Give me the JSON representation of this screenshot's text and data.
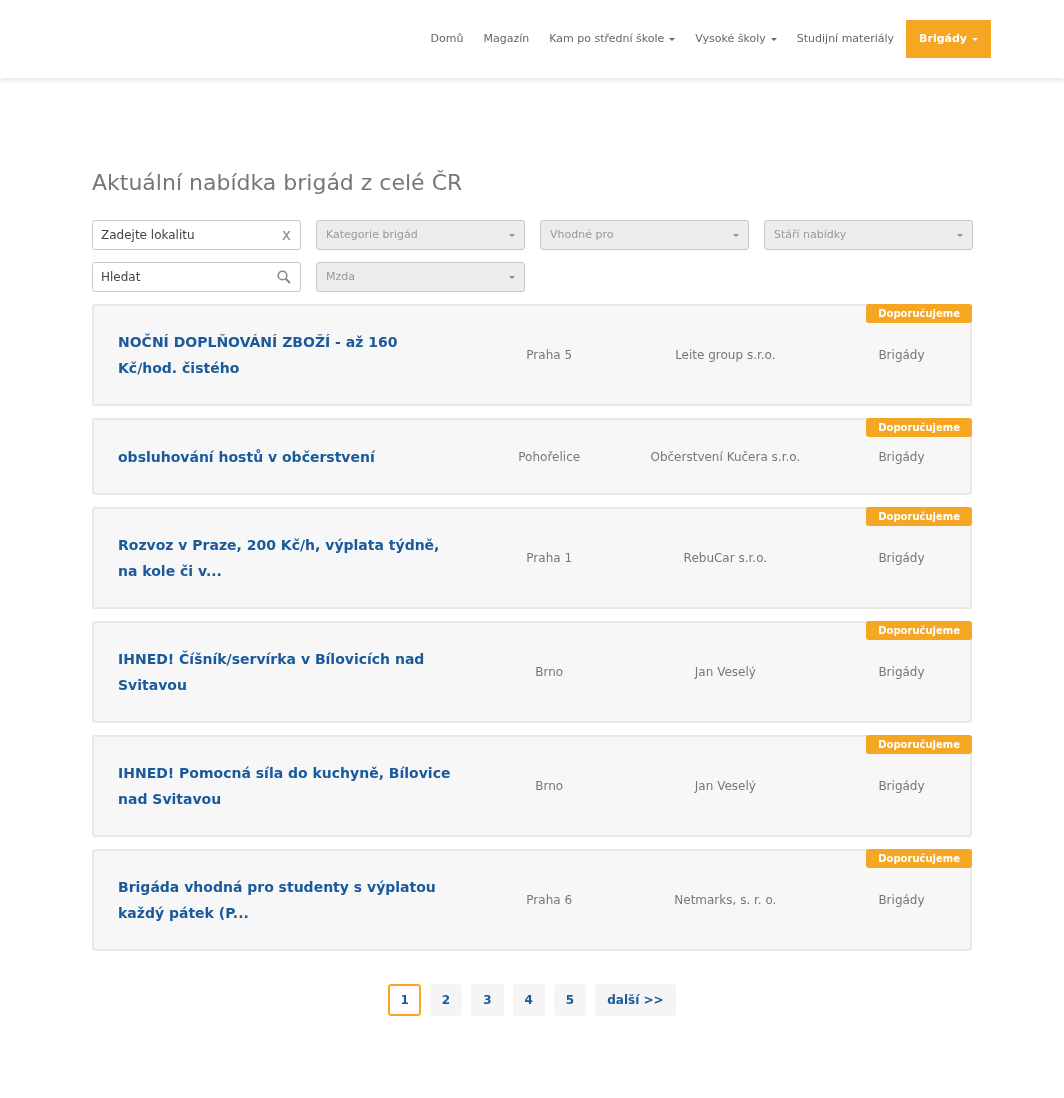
{
  "nav": [
    {
      "label": "Domů",
      "dropdown": false,
      "selected": false
    },
    {
      "label": "Magazín",
      "dropdown": false,
      "selected": false
    },
    {
      "label": "Kam po střední škole",
      "dropdown": true,
      "selected": false
    },
    {
      "label": "Vysoké školy",
      "dropdown": true,
      "selected": false
    },
    {
      "label": "Studijní materiály",
      "dropdown": false,
      "selected": false
    },
    {
      "label": "Brigády",
      "dropdown": true,
      "selected": true
    }
  ],
  "heading": "Aktuální nabídka brigád z celé ČR",
  "filters": [
    {
      "kind": "input",
      "placeholder": "Zadejte lokalitu",
      "clear": "x"
    },
    {
      "kind": "select",
      "placeholder": "Kategorie brigád"
    },
    {
      "kind": "select",
      "placeholder": "Vhodné pro"
    },
    {
      "kind": "select",
      "placeholder": "Stáří nabídky"
    },
    {
      "kind": "search",
      "placeholder": "Hledat"
    },
    {
      "kind": "select",
      "placeholder": "Mzda"
    }
  ],
  "jobs": [
    {
      "title": "NOČNÍ DOPLŇOVÁNÍ ZBOŽÍ - až 160 Kč/hod. čistého",
      "location": "Praha 5",
      "company": "Leite group s.r.o.",
      "category": "Brigády",
      "badge": "Doporučujeme"
    },
    {
      "title": "obsluhování hostů v občerstvení",
      "location": "Pohořelice",
      "company": "Občerstvení Kučera s.r.o.",
      "category": "Brigády",
      "badge": "Doporučujeme"
    },
    {
      "title": "Rozvoz v Praze, 200 Kč/h, výplata týdně, na kole či v...",
      "location": "Praha 1",
      "company": "RebuCar s.r.o.",
      "category": "Brigády",
      "badge": "Doporučujeme"
    },
    {
      "title": "IHNED! Číšník/servírka v Bílovicích nad Svitavou",
      "location": "Brno",
      "company": "Jan Veselý",
      "category": "Brigády",
      "badge": "Doporučujeme"
    },
    {
      "title": "IHNED! Pomocná síla do kuchyně, Bílovice nad Svitavou",
      "location": "Brno",
      "company": "Jan Veselý",
      "category": "Brigády",
      "badge": "Doporučujeme"
    },
    {
      "title": "Brigáda vhodná pro studenty s výplatou každý pátek (P...",
      "location": "Praha 6",
      "company": "Netmarks, s. r. o.",
      "category": "Brigády",
      "badge": "Doporučujeme"
    }
  ],
  "pagination": [
    {
      "label": "1",
      "selected": true
    },
    {
      "label": "2",
      "selected": false
    },
    {
      "label": "3",
      "selected": false
    },
    {
      "label": "4",
      "selected": false
    },
    {
      "label": "5",
      "selected": false
    },
    {
      "label": "další >>",
      "selected": false
    }
  ]
}
